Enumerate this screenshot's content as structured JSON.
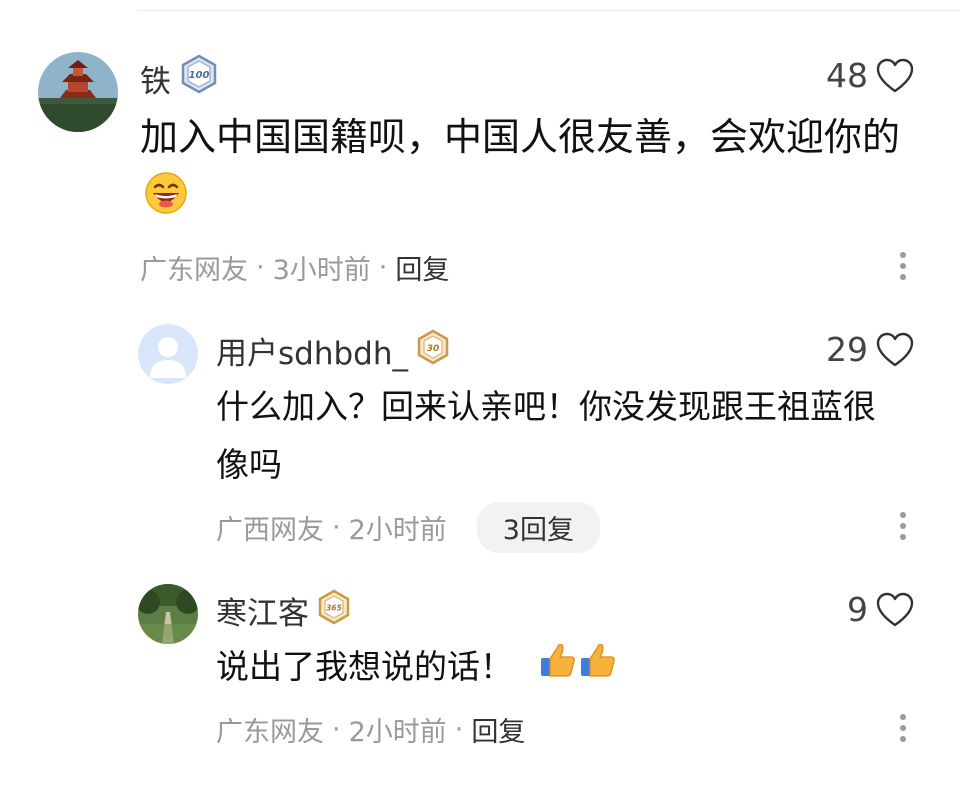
{
  "comments": [
    {
      "name": "铁",
      "badge": "100",
      "likes": "48",
      "content": "加入中国国籍呗，中国人很友善，会欢迎你的",
      "region": "广东网友",
      "time": "3小时前",
      "reply_label": "回复"
    }
  ],
  "replies": [
    {
      "name": "用户sdhbdh_",
      "badge": "30",
      "likes": "29",
      "content": "什么加入？回来认亲吧！你没发现跟王祖蓝很像吗",
      "region": "广西网友",
      "time": "2小时前",
      "reply_count_label": "3回复"
    },
    {
      "name": "寒江客",
      "badge": "365",
      "likes": "9",
      "content": "说出了我想说的话！",
      "region": "广东网友",
      "time": "2小时前",
      "reply_label": "回复"
    }
  ],
  "icons": {
    "like": "heart-outline-icon",
    "more": "more-vertical-icon",
    "emoji_grin": "grinning-face-emoji",
    "emoji_thumbs": "thumbs-up-emoji"
  },
  "colors": {
    "meta_text": "#9a9a9a",
    "badge_blue": "#6f8fb8",
    "badge_gold": "#c99a4a",
    "reply_pill_bg": "#f2f2f2"
  }
}
